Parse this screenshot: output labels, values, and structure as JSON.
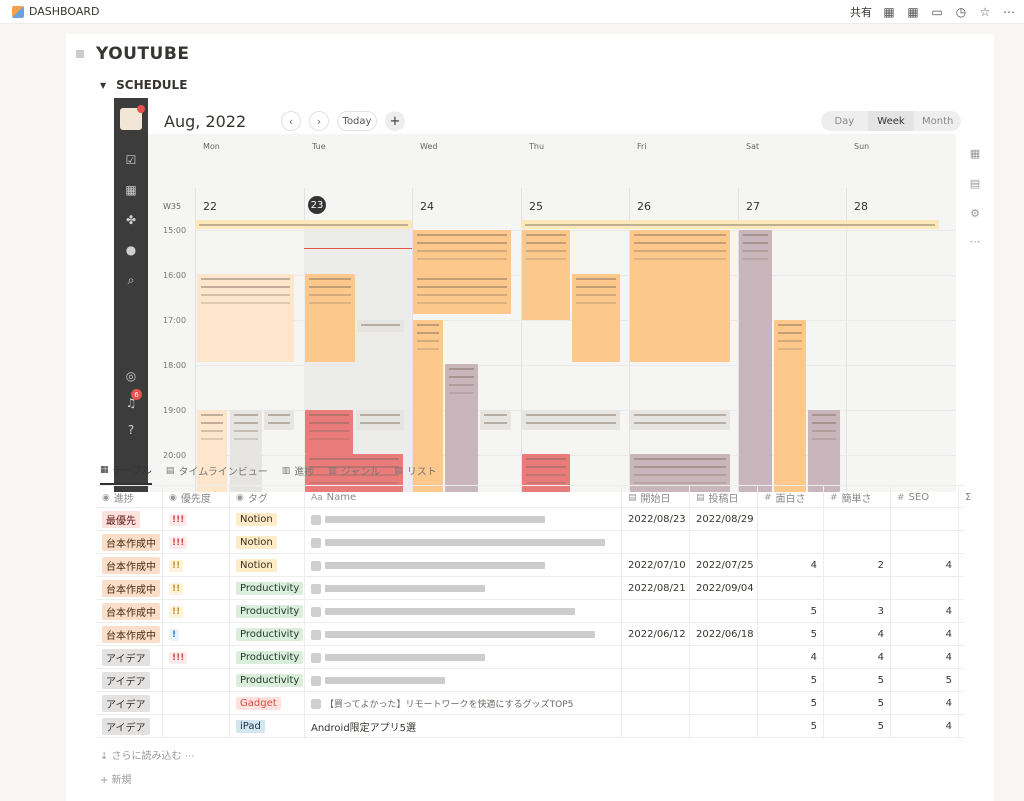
{
  "topbar": {
    "breadcrumb": "DASHBOARD",
    "share": "共有",
    "icons": [
      "grid-icon",
      "grid-icon",
      "comment-icon",
      "clock-icon",
      "star-icon",
      "more-icon"
    ]
  },
  "page": {
    "title": "YOUTUBE",
    "toggle_label": "SCHEDULE"
  },
  "calendar": {
    "month_label": "Aug, 2022",
    "prev": "‹",
    "next": "›",
    "today": "Today",
    "add": "+",
    "views": [
      "Day",
      "Week",
      "Month"
    ],
    "active_view": "Week",
    "week_label": "W35",
    "days": [
      {
        "name": "Mon",
        "num": "22"
      },
      {
        "name": "Tue",
        "num": "23"
      },
      {
        "name": "Wed",
        "num": "24"
      },
      {
        "name": "Thu",
        "num": "25"
      },
      {
        "name": "Fri",
        "num": "26"
      },
      {
        "name": "Sat",
        "num": "27"
      },
      {
        "name": "Sun",
        "num": "28"
      }
    ],
    "today_index": 1,
    "times": [
      "15:00",
      "16:00",
      "17:00",
      "18:00",
      "19:00",
      "20:00"
    ],
    "notification_count": "6",
    "colors": {
      "orange": "#fdc88c",
      "light_orange": "#fde6cc",
      "mauve": "#c9b6bd",
      "red": "#ea7b7b",
      "gray": "#e7e5e2",
      "yellow": "#fbe9bb"
    }
  },
  "db": {
    "tabs": [
      {
        "icon": "table-icon",
        "label": "テーブル"
      },
      {
        "icon": "timeline-icon",
        "label": "タイムラインビュー"
      },
      {
        "icon": "board-icon",
        "label": "進捗"
      },
      {
        "icon": "board-icon",
        "label": "ジャンル"
      },
      {
        "icon": "list-icon",
        "label": "リスト"
      }
    ],
    "columns": [
      "進捗",
      "優先度",
      "タグ",
      "Name",
      "開始日",
      "投稿日",
      "面白さ",
      "簡単さ",
      "SEO"
    ],
    "sigma": "Σ",
    "rows": [
      {
        "status": "最優先",
        "status_color": "red",
        "prio": "!!!",
        "prio_level": "p1",
        "tag": "Notion",
        "tag_color": "yellow",
        "name": "",
        "start": "2022/08/23",
        "post": "2022/08/29",
        "fun": "",
        "easy": "",
        "seo": ""
      },
      {
        "status": "台本作成中",
        "status_color": "orange",
        "prio": "!!!",
        "prio_level": "p1",
        "tag": "Notion",
        "tag_color": "yellow",
        "name": "",
        "start": "",
        "post": "",
        "fun": "",
        "easy": "",
        "seo": ""
      },
      {
        "status": "台本作成中",
        "status_color": "orange",
        "prio": "!!",
        "prio_level": "p2",
        "tag": "Notion",
        "tag_color": "yellow",
        "name": "",
        "start": "2022/07/10",
        "post": "2022/07/25",
        "fun": "4",
        "easy": "2",
        "seo": "4"
      },
      {
        "status": "台本作成中",
        "status_color": "orange",
        "prio": "!!",
        "prio_level": "p2",
        "tag": "Productivity",
        "tag_color": "green",
        "name": "",
        "start": "2022/08/21",
        "post": "2022/09/04",
        "fun": "",
        "easy": "",
        "seo": ""
      },
      {
        "status": "台本作成中",
        "status_color": "orange",
        "prio": "!!",
        "prio_level": "p2",
        "tag": "Productivity",
        "tag_color": "green",
        "name": "",
        "start": "",
        "post": "",
        "fun": "5",
        "easy": "3",
        "seo": "4"
      },
      {
        "status": "台本作成中",
        "status_color": "orange",
        "prio": "!",
        "prio_level": "p3",
        "tag": "Productivity",
        "tag_color": "green",
        "name": "",
        "start": "2022/06/12",
        "post": "2022/06/18",
        "fun": "5",
        "easy": "4",
        "seo": "4"
      },
      {
        "status": "アイデア",
        "status_color": "gray",
        "prio": "!!!",
        "prio_level": "p1",
        "tag": "Productivity",
        "tag_color": "green",
        "name": "",
        "start": "",
        "post": "",
        "fun": "4",
        "easy": "4",
        "seo": "4"
      },
      {
        "status": "アイデア",
        "status_color": "gray",
        "prio": "",
        "prio_level": "",
        "tag": "Productivity",
        "tag_color": "green",
        "name": "",
        "start": "",
        "post": "",
        "fun": "5",
        "easy": "5",
        "seo": "5"
      },
      {
        "status": "アイデア",
        "status_color": "gray",
        "prio": "",
        "prio_level": "",
        "tag": "Gadget",
        "tag_color": "redtag",
        "name": "【買ってよかった】リモートワークを快適にするグッズTOP5",
        "start": "",
        "post": "",
        "fun": "5",
        "easy": "5",
        "seo": "4"
      },
      {
        "status": "アイデア",
        "status_color": "gray",
        "prio": "",
        "prio_level": "",
        "tag": "iPad",
        "tag_color": "blue",
        "name": "Android限定アプリ5選",
        "start": "",
        "post": "",
        "fun": "5",
        "easy": "5",
        "seo": "4"
      }
    ],
    "load_more": "↓ さらに読み込む ⋯",
    "new": "+ 新規"
  }
}
